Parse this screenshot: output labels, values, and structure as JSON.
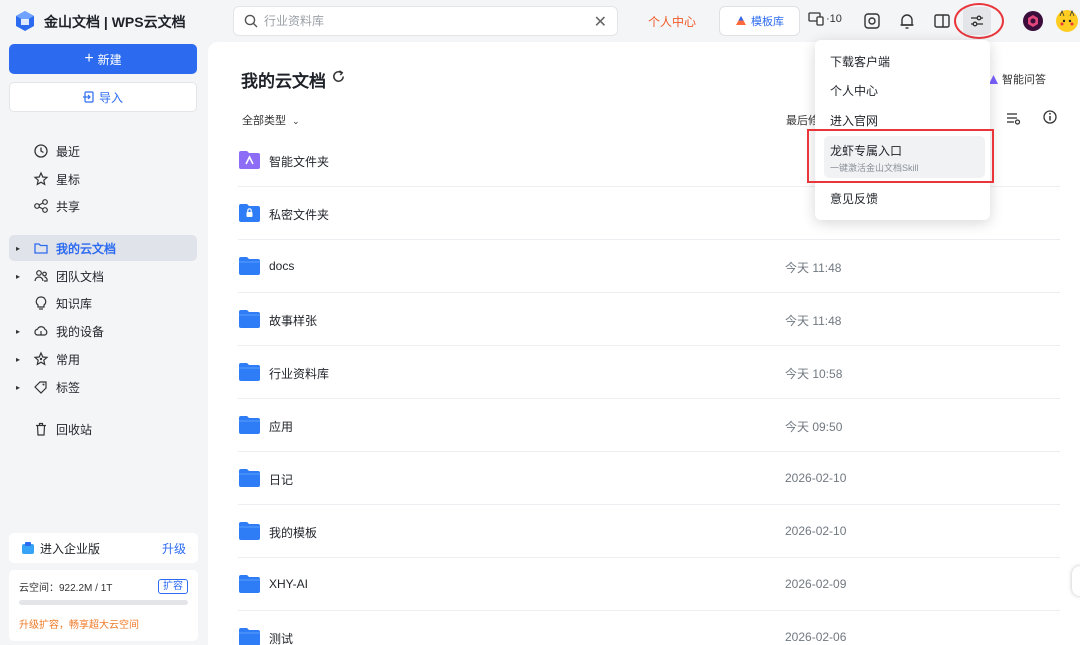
{
  "app": {
    "brand": "金山文档 | WPS云文档"
  },
  "topbar": {
    "search_placeholder": "行业资料库",
    "personal_center": "个人中心",
    "template_btn": "模板库",
    "devices_label": "·10"
  },
  "sidebar": {
    "new_btn": "新建",
    "import_btn": "导入",
    "items": [
      {
        "label": "最近",
        "icon": "clock-icon",
        "arrow": false,
        "active": false
      },
      {
        "label": "星标",
        "icon": "star-icon",
        "arrow": false,
        "active": false
      },
      {
        "label": "共享",
        "icon": "share-icon",
        "arrow": false,
        "active": false
      },
      {
        "label": "我的云文档",
        "icon": "folder-icon",
        "arrow": true,
        "active": true
      },
      {
        "label": "团队文档",
        "icon": "team-icon",
        "arrow": true,
        "active": false
      },
      {
        "label": "知识库",
        "icon": "bulb-icon",
        "arrow": false,
        "active": false
      },
      {
        "label": "我的设备",
        "icon": "cloud-device-icon",
        "arrow": true,
        "active": false
      },
      {
        "label": "常用",
        "icon": "pin-icon",
        "arrow": true,
        "active": false
      },
      {
        "label": "标签",
        "icon": "tag-icon",
        "arrow": true,
        "active": false
      },
      {
        "label": "回收站",
        "icon": "trash-icon",
        "arrow": false,
        "active": false
      }
    ],
    "enterprise": {
      "label": "进入企业版",
      "upgrade": "升级"
    },
    "storage": {
      "label": "云空间：922.2M / 1T",
      "expand": "扩容",
      "promo": "升级扩容，畅享超大云空间"
    }
  },
  "main": {
    "title": "我的云文档",
    "ai_ask": "智能问答",
    "filter": "全部类型",
    "last_column": "最后修",
    "files": [
      {
        "name": "智能文件夹",
        "date": "",
        "icon": "smart"
      },
      {
        "name": "私密文件夹",
        "date": "",
        "icon": "private"
      },
      {
        "name": "docs",
        "date": "今天 11:48",
        "icon": "folder"
      },
      {
        "name": "故事样张",
        "date": "今天 11:48",
        "icon": "folder"
      },
      {
        "name": "行业资料库",
        "date": "今天 10:58",
        "icon": "folder"
      },
      {
        "name": "应用",
        "date": "今天 09:50",
        "icon": "folder"
      },
      {
        "name": "日记",
        "date": "2026-02-10",
        "icon": "folder"
      },
      {
        "name": "我的模板",
        "date": "2026-02-10",
        "icon": "folder"
      },
      {
        "name": "XHY-AI",
        "date": "2026-02-09",
        "icon": "folder"
      },
      {
        "name": "测试",
        "date": "2026-02-06",
        "icon": "folder"
      }
    ]
  },
  "dropdown": {
    "items": [
      "下载客户端",
      "个人中心",
      "进入官网",
      "龙虾专属入口",
      "意见反馈"
    ],
    "sub": "一键激活金山文档Skill"
  },
  "colors": {
    "accent": "#2c6bf0",
    "highlight_red": "#e8363b",
    "orange": "#f05a28"
  }
}
